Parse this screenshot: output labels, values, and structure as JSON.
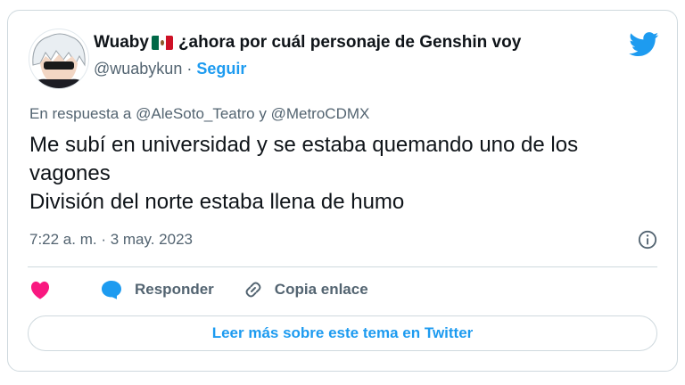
{
  "tweet": {
    "author_name": "Wuaby",
    "author_name_suffix": "¿ahora por cuál personaje de Genshin voy",
    "handle": "@wuabykun",
    "separator": " · ",
    "follow_label": "Seguir",
    "reply_prefix": "En respuesta a",
    "reply_mention_1": "@AleSoto_Teatro",
    "reply_conjunction": "y",
    "reply_mention_2": "@MetroCDMX",
    "body_lines": [
      "Me subí en universidad y se estaba quemando uno de los",
      "vagones",
      "División del norte estaba llena de humo"
    ],
    "timestamp": "7:22 a. m. · 3 may. 2023"
  },
  "actions": {
    "reply_label": "Responder",
    "copy_link_label": "Copia enlace"
  },
  "read_more_label": "Leer más sobre este tema en Twitter",
  "icons": {
    "brand": "twitter-bird-icon",
    "like": "heart-icon",
    "reply": "speech-bubble-icon",
    "copy": "link-icon",
    "info": "info-icon",
    "flag": "mexico-flag-icon"
  },
  "colors": {
    "accent": "#1d9bf0",
    "like": "#f91880",
    "text": "#0f1419",
    "muted": "#536471",
    "border": "#cfd9de"
  }
}
